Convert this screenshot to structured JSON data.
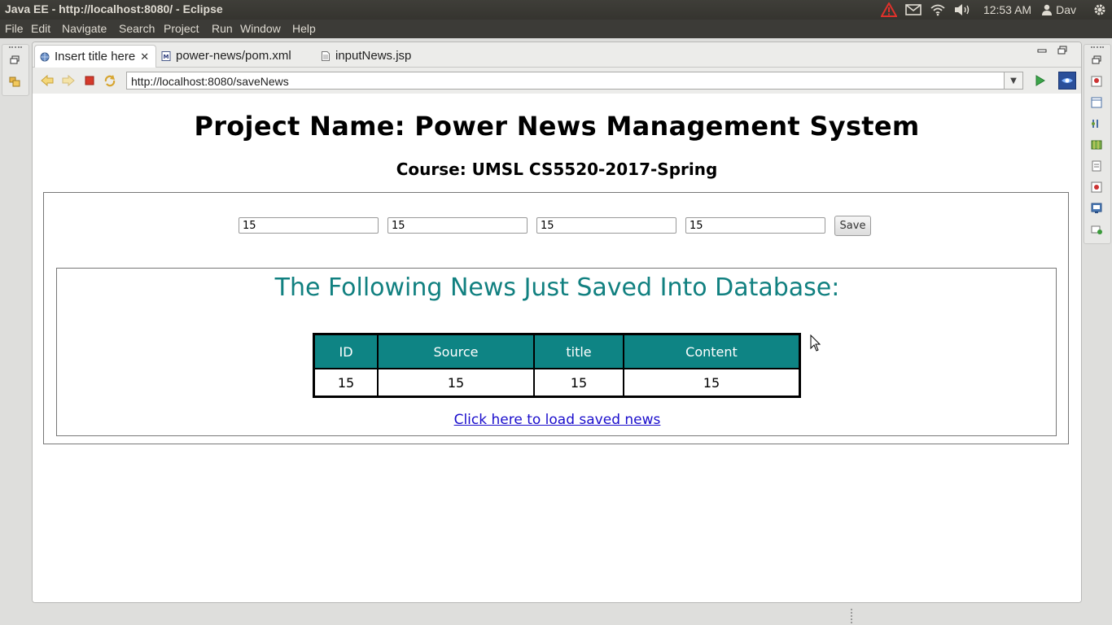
{
  "window": {
    "title": "Java EE - http://localhost:8080/ - Eclipse"
  },
  "tray": {
    "time": "12:53 AM",
    "user": "Dav"
  },
  "menu": [
    "File",
    "Edit",
    "Navigate",
    "Search",
    "Project",
    "Run",
    "Window",
    "Help"
  ],
  "tabs": [
    {
      "label": "Insert title here",
      "active": true
    },
    {
      "label": "power-news/pom.xml",
      "active": false
    },
    {
      "label": "inputNews.jsp",
      "active": false
    }
  ],
  "browser": {
    "url": "http://localhost:8080/saveNews"
  },
  "page": {
    "heading": "Project Name:  Power News Management System",
    "course": "Course: UMSL CS5520-2017-Spring",
    "form": {
      "values": [
        "15",
        "15",
        "15",
        "15"
      ],
      "save_label": "Save"
    },
    "result_title": "The Following News Just Saved Into Database:",
    "table": {
      "headers": [
        "ID",
        "Source",
        "title",
        "Content"
      ],
      "rows": [
        [
          "15",
          "15",
          "15",
          "15"
        ]
      ]
    },
    "load_link": "Click here to load saved news"
  },
  "colors": {
    "accent": "#118080",
    "table_header": "#0e8484",
    "link": "#1a0dcc"
  }
}
